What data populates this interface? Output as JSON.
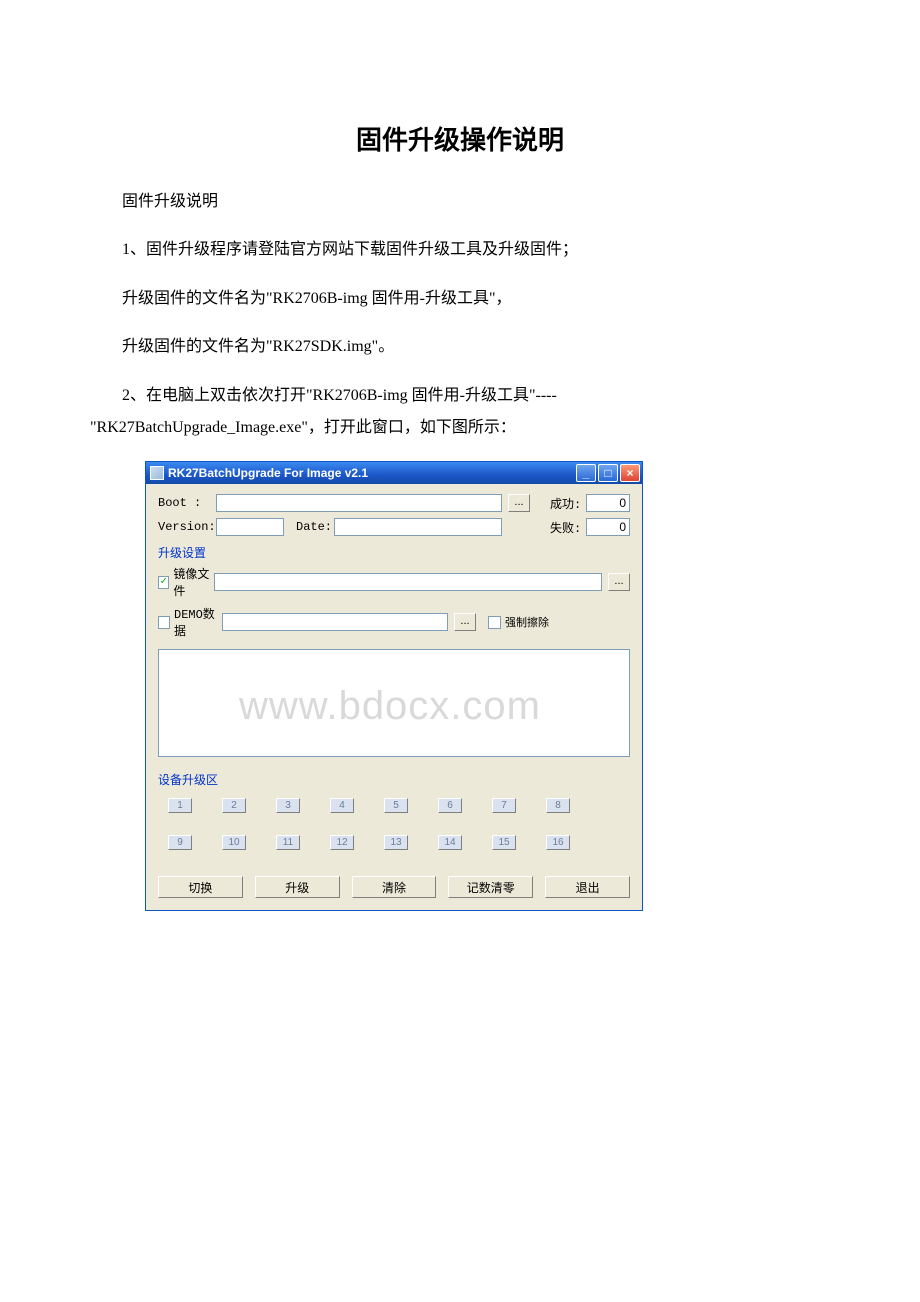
{
  "document": {
    "title": "固件升级操作说明",
    "intro": "固件升级说明",
    "p1": "1、固件升级程序请登陆官方网站下载固件升级工具及升级固件；",
    "p2": "升级固件的文件名为\"RK2706B-img 固件用-升级工具\"，",
    "p3": "升级固件的文件名为\"RK27SDK.img\"。",
    "p4a": "2、在电脑上双击依次打开\"RK2706B-img 固件用-升级工具\"----",
    "p4b": "\"RK27BatchUpgrade_Image.exe\"，打开此窗口，如下图所示："
  },
  "app": {
    "title": "RK27BatchUpgrade For Image v2.1",
    "boot_label": "Boot :",
    "browse": "...",
    "success_label": "成功:",
    "success_value": "0",
    "fail_label": "失败:",
    "fail_value": "0",
    "version_label": "Version:",
    "date_label": "Date:",
    "upgrade_settings": "升级设置",
    "mirror_file": "镜像文件",
    "demo_data": "DEMO数据",
    "force_erase": "强制擦除",
    "device_section": "设备升级区",
    "slots1": [
      "1",
      "2",
      "3",
      "4",
      "5",
      "6",
      "7",
      "8"
    ],
    "slots2": [
      "9",
      "10",
      "11",
      "12",
      "13",
      "14",
      "15",
      "16"
    ],
    "buttons": {
      "switch": "切换",
      "upgrade": "升级",
      "clear": "清除",
      "reset_count": "记数清零",
      "exit": "退出"
    },
    "winbtn_min": "_",
    "winbtn_max": "□",
    "winbtn_close": "×"
  },
  "watermark": "www.bdocx.com"
}
